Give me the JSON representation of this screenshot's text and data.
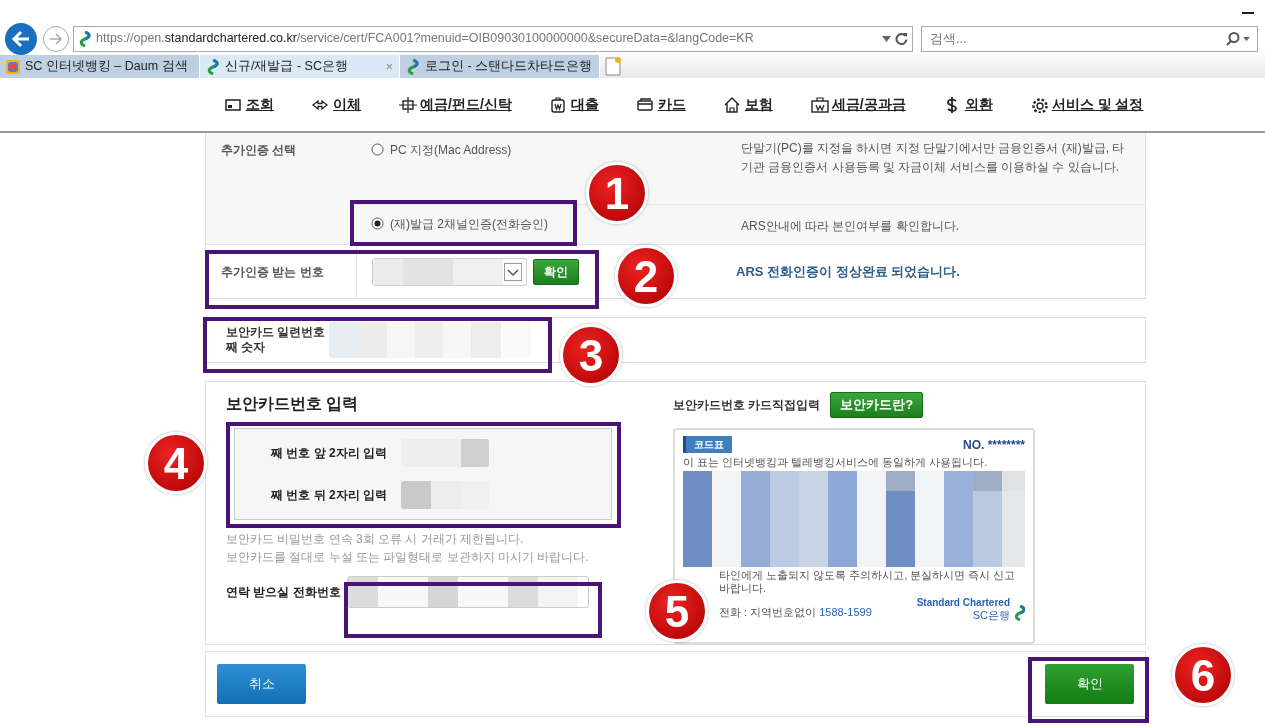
{
  "browser": {
    "url": "https://open.**standardchartered.co.kr**/service/cert/FCA001?menuid=OIB09030100000000&secureData=&langCode=KR",
    "search": {
      "placeholder": "검색..."
    },
    "tabs": [
      {
        "label": "SC 인터넷뱅킹 – Daum 검색",
        "selected": false,
        "kind": "daum"
      },
      {
        "label": "신규/재발급 - SC은행",
        "selected": true,
        "kind": "sc",
        "close": "×"
      },
      {
        "label": "로그인 - 스탠다드차타드은행",
        "selected": false,
        "kind": "sc"
      }
    ]
  },
  "nav": [
    {
      "label": "조회",
      "kind": "inquiry"
    },
    {
      "label": "이체",
      "kind": "transfer"
    },
    {
      "label": "예금/펀드/신탁",
      "kind": "deposit"
    },
    {
      "label": "대출",
      "kind": "loan"
    },
    {
      "label": "카드",
      "kind": "card"
    },
    {
      "label": "보험",
      "kind": "insurance"
    },
    {
      "label": "세금/공과금",
      "kind": "tax"
    },
    {
      "label": "외환",
      "kind": "fx"
    },
    {
      "label": "서비스 및 설정",
      "kind": "settings"
    }
  ],
  "auth": {
    "label": "추가인증 선택",
    "options": [
      {
        "label": "PC 지정(Mac Address)",
        "selected": false,
        "description": "단말기(PC)를 지정을 하시면 지정 단말기에서만 금융인증서 (재)발급, 타기관 금융인증서 사용등록 및 자금이체 서비스를 이용하실 수 있습니다."
      },
      {
        "label": "(재)발급 2채널인증(전화승인)",
        "selected": true,
        "description": "ARS안내에 따라 본인여부를 확인합니다."
      }
    ],
    "number_label": "추가인증 받는 번호",
    "confirm_button": "확인",
    "message": "ARS 전화인증이 정상완료 되었습니다."
  },
  "serial": {
    "label_line1": "보안카드 일련번호",
    "label_line2": "째 숫자"
  },
  "security_card": {
    "title": "보안카드번호 입력",
    "rows": [
      {
        "label": "째 번호 **앞** 2자리 입력"
      },
      {
        "label": "째 번호 **뒤** 2자리 입력"
      }
    ],
    "notes": [
      "보안카드 비밀번호 연속 3회 오류 시 거래가 제한됩니다.",
      "보안카드를 절대로 누설 또는 파일형태로 보관하지 마시기 바랍니다."
    ],
    "phone_label": "연락 받으실 전화번호",
    "direct_label": "보안카드번호 카드직접입력",
    "help_button": "보안카드란?",
    "card": {
      "badge": "코드표",
      "header": "이 표는 인터넷뱅킹과 텔레뱅킹서비스에 동일하게 사용됩니다.",
      "number": "NO. ********",
      "footer1": "타인에게 노출되지 않도록 주의하시고, 분실하시면 즉시 신고 바랍니다.",
      "footer2": "전화 : 지역번호없이",
      "footer_phone": "1588-1599",
      "brand": "Standard Chartered",
      "brand_sub": "SC은행"
    }
  },
  "buttons": {
    "cancel": "취소",
    "ok": "확인"
  },
  "annotations": [
    "1",
    "2",
    "3",
    "4",
    "5",
    "6"
  ]
}
